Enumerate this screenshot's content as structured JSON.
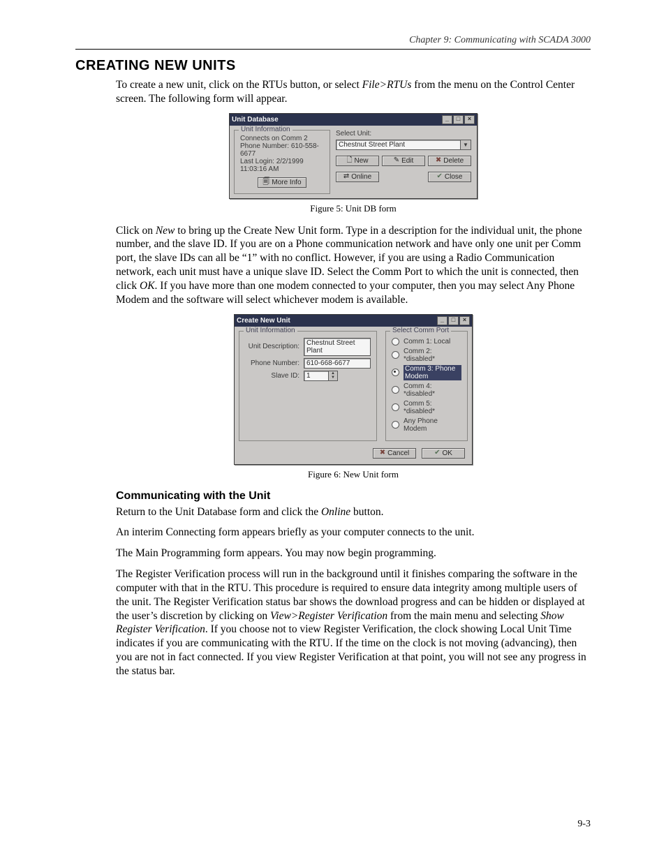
{
  "header": {
    "running_head": "Chapter 9: Communicating with SCADA 3000"
  },
  "section_title": "CREATING NEW UNITS",
  "para1_a": "To create a new unit, click on the RTUs button, or select ",
  "para1_ital": "File>RTUs",
  "para1_b": " from the menu on the Control Center screen.  The following form will appear.",
  "fig5": {
    "title": "Unit Database",
    "group_legend": "Unit Information",
    "connects": "Connects on Comm 2",
    "phone": "Phone Number:  610-558-6677",
    "last_login": "Last Login: 2/2/1999 11:03:16 AM",
    "more_info": "More Info",
    "select_unit_label": "Select Unit:",
    "select_unit_value": "Chestnut Street Plant",
    "btn_new": "New",
    "btn_edit": "Edit",
    "btn_delete": "Delete",
    "btn_online": "Online",
    "btn_close": "Close"
  },
  "caption5": "Figure 5: Unit DB form",
  "para2_a": "Click on ",
  "para2_new": "New",
  "para2_b": " to bring up the Create New Unit form. Type in a description for the individual unit, the phone number, and the slave ID. If you are on a Phone communication network and have only one unit per Comm port, the slave IDs can all be “1” with no conflict. However, if you are using a Radio Communication network, each unit must have a unique slave ID. Select the Comm Port to which the unit is connected, then click ",
  "para2_ok": "OK",
  "para2_c": ". If you have more than one modem connected to your computer, then you may select Any Phone Modem and the software will select whichever modem is available.",
  "fig6": {
    "title": "Create New Unit",
    "left_legend": "Unit Information",
    "desc_label": "Unit Description:",
    "desc_value": "Chestnut Street Plant",
    "phone_label": "Phone Number:",
    "phone_value": "610-668-6677",
    "slave_label": "Slave ID:",
    "slave_value": "1",
    "right_legend": "Select Comm Port",
    "opts": [
      "Comm 1: Local",
      "Comm 2: *disabled*",
      "Comm 3: Phone Modem",
      "Comm 4: *disabled*",
      "Comm 5: *disabled*",
      "Any Phone Modem"
    ],
    "selected_index": 2,
    "btn_cancel": "Cancel",
    "btn_ok": "OK"
  },
  "caption6": "Figure 6: New Unit form",
  "subheading": "Communicating with the Unit",
  "p_sub_1a": "Return to the Unit Database form and click the ",
  "p_sub_1_ital": "Online",
  "p_sub_1b": " button.",
  "p_sub_2": "An interim Connecting form appears briefly as your computer connects to the unit.",
  "p_sub_3": "The Main Programming form appears. You may now begin programming.",
  "p_sub_4a": "The Register Verification process will run in the background until it finishes comparing the software in the computer with that in the RTU. This procedure is required to ensure data integrity among multiple users of the unit. The Register Verification status bar shows the download progress and can be hidden or displayed at the user’s discretion by clicking on ",
  "p_sub_4_ital1": "View>Register Verification",
  "p_sub_4b": " from the main menu and selecting ",
  "p_sub_4_ital2": "Show Register Verification",
  "p_sub_4c": ". If you choose not to view Register Verification, the clock showing Local Unit Time indicates if you are communicating with the RTU.  If the time on the clock is not moving (advancing), then you are not in fact connected. If you view Register Verification at that point, you will not see any progress in the status bar.",
  "page_number": "9-3"
}
